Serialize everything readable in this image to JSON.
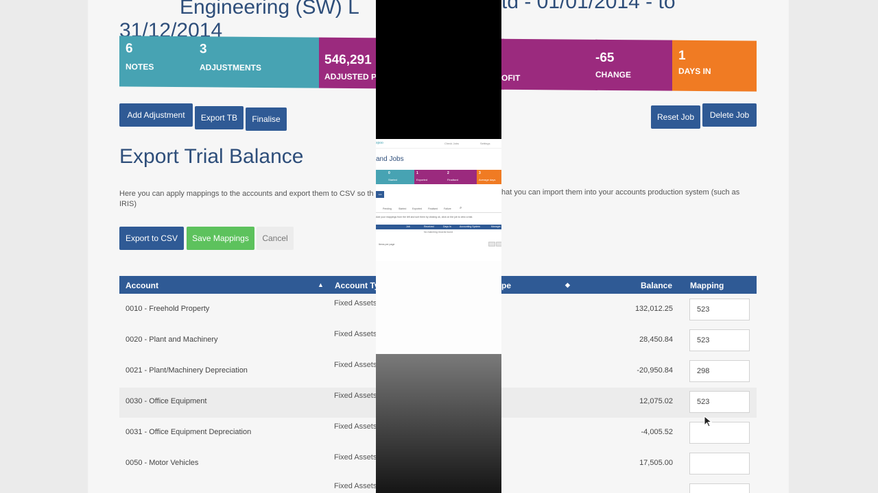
{
  "background": {
    "title_line1": "Engineering (SW) L",
    "title_line2": "31/12/2014",
    "title_right": "td - 01/01/2014 - to",
    "stats": [
      {
        "value": "6",
        "label": "Notes",
        "color": "#47a3b3"
      },
      {
        "value": "3",
        "label": "Adjustments",
        "color": "#47a3b3"
      },
      {
        "value": "546,291",
        "label": "Adjusted Pr",
        "color": "#9b2a7e"
      },
      {
        "value": "",
        "label": "ofit",
        "color": "#9b2a7e"
      },
      {
        "value": "-65",
        "label": "Change",
        "color": "#9b2a7e"
      },
      {
        "value": "1",
        "label": "Days in",
        "color": "#f07b23"
      }
    ],
    "buttons": {
      "add_adjustment": "Add Adjustment",
      "export_tb": "Export TB",
      "finalise": "Finalise",
      "reset_job": "Reset Job",
      "delete_job": "Delete Job"
    },
    "section_title": "Export Trial Balance",
    "description_left": "Here you can apply mappings to the accounts and export them to CSV so th",
    "description_left_2": "IRIS)",
    "description_right": "hat you can import them into your accounts production system (such as",
    "actions": {
      "export_csv": "Export to CSV",
      "save_mappings": "Save Mappings",
      "cancel": "Cancel"
    },
    "table": {
      "headers": {
        "account": "Account",
        "account_type": "Account Ty",
        "type_right": "pe",
        "balance": "Balance",
        "mapping": "Mapping"
      },
      "rows": [
        {
          "account": "0010 - Freehold Property",
          "type": "Fixed Assets",
          "balance": "132,012.25",
          "mapping": "523"
        },
        {
          "account": "0020 - Plant and Machinery",
          "type": "Fixed Assets",
          "balance": "28,450.84",
          "mapping": "523"
        },
        {
          "account": "0021 - Plant/Machinery Depreciation",
          "type": "Fixed Assets",
          "balance": "-20,950.84",
          "mapping": "298"
        },
        {
          "account": "0030 - Office Equipment",
          "type": "Fixed Assets",
          "balance": "12,075.02",
          "mapping": "523"
        },
        {
          "account": "0031 - Office Equipment Depreciation",
          "type": "Fixed Assets",
          "balance": "-4,005.52",
          "mapping": ""
        },
        {
          "account": "0050 - Motor Vehicles",
          "type": "Fixed Assets",
          "balance": "17,505.00",
          "mapping": ""
        },
        {
          "account": "",
          "type": "Fixed Assets",
          "balance": "",
          "mapping": ""
        }
      ]
    }
  },
  "overlay": {
    "brand": "xpoo",
    "top_link_1": "Check Jobs",
    "top_link_2": "Settings",
    "heading": "and Jobs",
    "tiles": [
      {
        "value": "0",
        "label": "Started",
        "color": "#47a3b3"
      },
      {
        "value": "1",
        "label": "Exported",
        "color": "#9b2a7e"
      },
      {
        "value": "2",
        "label": "Finalised",
        "color": "#9b2a7e"
      },
      {
        "value": "3",
        "label": "Average days",
        "color": "#f07b23"
      }
    ],
    "filters": [
      "Pending",
      "Started",
      "Exported",
      "Finalised",
      "Failure"
    ],
    "note": "Add your mappings from the left and sort them by clicking ok, click on the job to view a trial.",
    "columns": [
      "Job",
      "Received",
      "Days In",
      "Accounting System",
      "Manager"
    ],
    "empty_text": "No matching records found",
    "items_per_page": "Items per page"
  }
}
